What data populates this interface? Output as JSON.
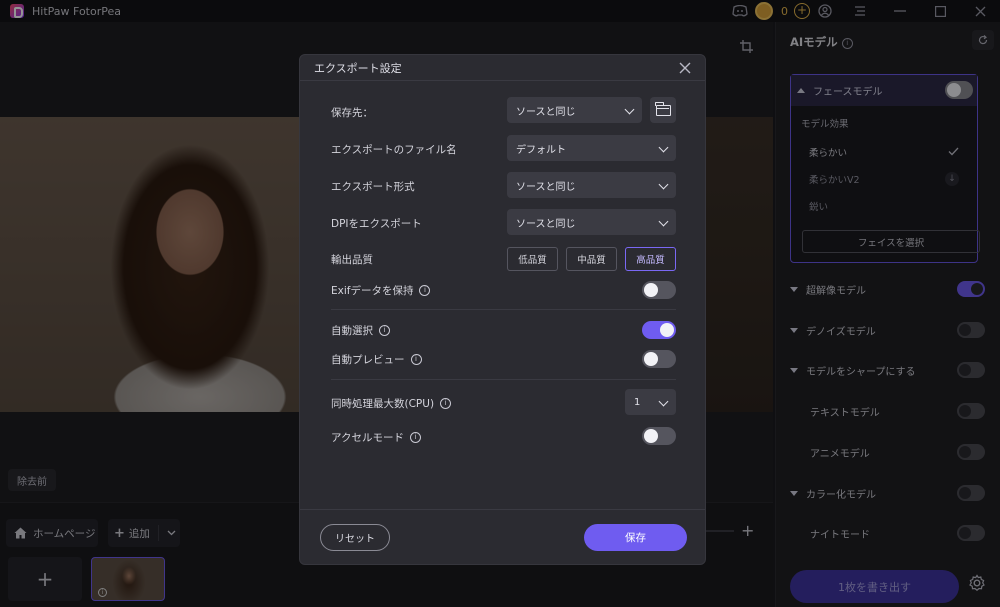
{
  "app": {
    "title": "HitPaw FotorPea",
    "coins": "0"
  },
  "canvas": {
    "before_label": "除去前"
  },
  "bottombar": {
    "home_label": "ホームページ",
    "add_label": "追加"
  },
  "right_panel": {
    "title": "AIモデル",
    "face_model": {
      "label": "フェースモデル",
      "enabled": true,
      "effect_label": "モデル効果",
      "options": [
        {
          "label": "柔らかい",
          "selected": true
        },
        {
          "label": "柔らかいV2",
          "selected": false
        },
        {
          "label": "鋭い",
          "selected": false
        }
      ],
      "select_face_label": "フェイスを選択"
    },
    "models": [
      {
        "label": "超解像モデル",
        "enabled": true,
        "expandable": true
      },
      {
        "label": "デノイズモデル",
        "enabled": false,
        "expandable": true
      },
      {
        "label": "モデルをシャープにする",
        "enabled": false,
        "expandable": true
      },
      {
        "label": "テキストモデル",
        "enabled": false,
        "expandable": false
      },
      {
        "label": "アニメモデル",
        "enabled": false,
        "expandable": false
      },
      {
        "label": "カラー化モデル",
        "enabled": false,
        "expandable": true
      },
      {
        "label": "ナイトモード",
        "enabled": false,
        "expandable": false
      }
    ],
    "export_label": "1枚を書き出す"
  },
  "dialog": {
    "title": "エクスポート設定",
    "save_dest": {
      "label": "保存先：",
      "value": "ソースと同じ"
    },
    "file_name": {
      "label": "エクスポートのファイル名",
      "value": "デフォルト"
    },
    "format": {
      "label": "エクスポート形式",
      "value": "ソースと同じ"
    },
    "dpi": {
      "label": "DPIをエクスポート",
      "value": "ソースと同じ"
    },
    "quality": {
      "label": "輸出品質",
      "options": [
        "低品質",
        "中品質",
        "高品質"
      ],
      "selected": "高品質"
    },
    "exif": {
      "label": "Exifデータを保持",
      "enabled": false
    },
    "auto_select": {
      "label": "自動選択",
      "enabled": true
    },
    "auto_preview": {
      "label": "自動プレビュー",
      "enabled": false
    },
    "max_concurrent": {
      "label": "同時処理最大数(CPU)",
      "value": "1"
    },
    "accel_mode": {
      "label": "アクセルモード",
      "enabled": false
    },
    "reset_label": "リセット",
    "save_label": "保存"
  }
}
